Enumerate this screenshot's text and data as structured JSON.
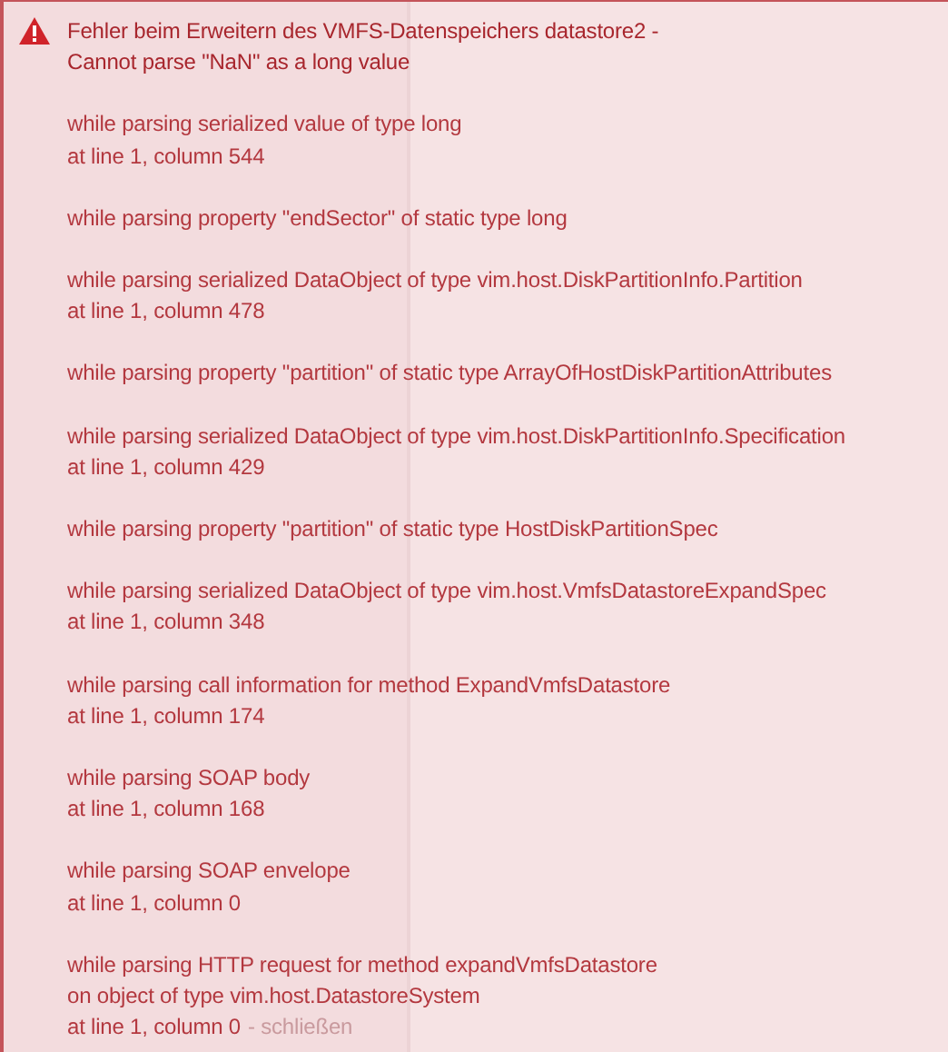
{
  "error": {
    "title_lines": [
      "Fehler beim Erweitern des VMFS-Datenspeichers datastore2 -",
      "Cannot parse \"NaN\" as a long value"
    ],
    "blocks": [
      {
        "lines": [
          "while parsing serialized value of type long",
          "at line 1, column 544"
        ]
      },
      {
        "lines": [
          "while parsing property \"endSector\" of static type long"
        ]
      },
      {
        "lines": [
          "while parsing serialized DataObject of type vim.host.DiskPartitionInfo.Partition",
          "at line 1, column 478"
        ]
      },
      {
        "lines": [
          "while parsing property \"partition\" of static type ArrayOfHostDiskPartitionAttributes"
        ]
      },
      {
        "lines": [
          "while parsing serialized DataObject of type vim.host.DiskPartitionInfo.Specification",
          "at line 1, column 429"
        ]
      },
      {
        "lines": [
          "while parsing property \"partition\" of static type HostDiskPartitionSpec"
        ]
      },
      {
        "lines": [
          "while parsing serialized DataObject of type vim.host.VmfsDatastoreExpandSpec",
          "at line 1, column 348"
        ]
      },
      {
        "lines": [
          "while parsing call information for method ExpandVmfsDatastore",
          "at line 1, column 174"
        ]
      },
      {
        "lines": [
          "while parsing SOAP body",
          "at line 1, column 168"
        ]
      },
      {
        "lines": [
          "while parsing SOAP envelope",
          "at line 1, column 0"
        ]
      },
      {
        "lines": [
          "while parsing HTTP request for method expandVmfsDatastore",
          "on object of type vim.host.DatastoreSystem",
          "at line 1, column 0"
        ]
      }
    ],
    "close_link": "- schließen"
  }
}
